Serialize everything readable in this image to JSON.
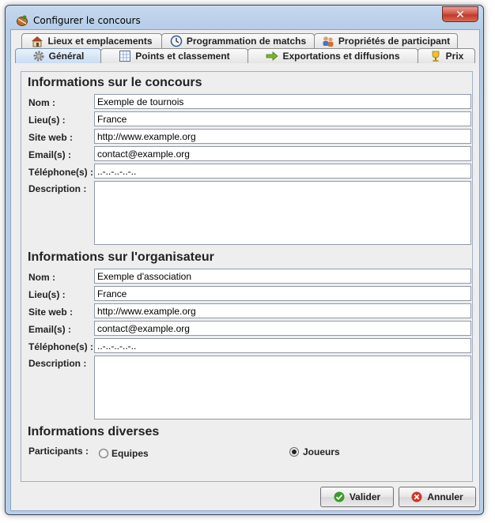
{
  "window": {
    "title": "Configurer le concours",
    "close_label": "✕"
  },
  "tabs": {
    "row1": [
      {
        "label": "Lieux et emplacements",
        "icon": "house-icon"
      },
      {
        "label": "Programmation de matchs",
        "icon": "clock-icon"
      },
      {
        "label": "Propriétés de participant",
        "icon": "users-icon"
      }
    ],
    "row2": [
      {
        "label": "Général",
        "icon": "gear-icon",
        "active": true
      },
      {
        "label": "Points et classement",
        "icon": "grid-icon"
      },
      {
        "label": "Exportations et diffusions",
        "icon": "arrow-right-icon"
      },
      {
        "label": "Prix",
        "icon": "trophy-icon"
      }
    ]
  },
  "competition": {
    "title": "Informations sur le concours",
    "name_label": "Nom :",
    "name_value": "Exemple de tournois",
    "place_label": "Lieu(s) :",
    "place_value": "France",
    "website_label": "Site web :",
    "website_value": "http://www.example.org",
    "email_label": "Email(s) :",
    "email_value": "contact@example.org",
    "phone_label": "Téléphone(s) :",
    "phone_value": "..-..-..-..-..",
    "description_label": "Description :",
    "description_value": ""
  },
  "organizer": {
    "title": "Informations sur l'organisateur",
    "name_label": "Nom :",
    "name_value": "Exemple d'association",
    "place_label": "Lieu(s) :",
    "place_value": "France",
    "website_label": "Site web :",
    "website_value": "http://www.example.org",
    "email_label": "Email(s) :",
    "email_value": "contact@example.org",
    "phone_label": "Téléphone(s) :",
    "phone_value": "..-..-..-..-..",
    "description_label": "Description :",
    "description_value": ""
  },
  "misc": {
    "title": "Informations diverses",
    "participants_label": "Participants :",
    "option_teams": "Equipes",
    "option_players": "Joueurs",
    "selected": "Joueurs"
  },
  "buttons": {
    "ok_label": "Valider",
    "cancel_label": "Annuler"
  },
  "colors": {
    "ok_icon": "#3a9a2a",
    "cancel_icon": "#d0342a"
  }
}
